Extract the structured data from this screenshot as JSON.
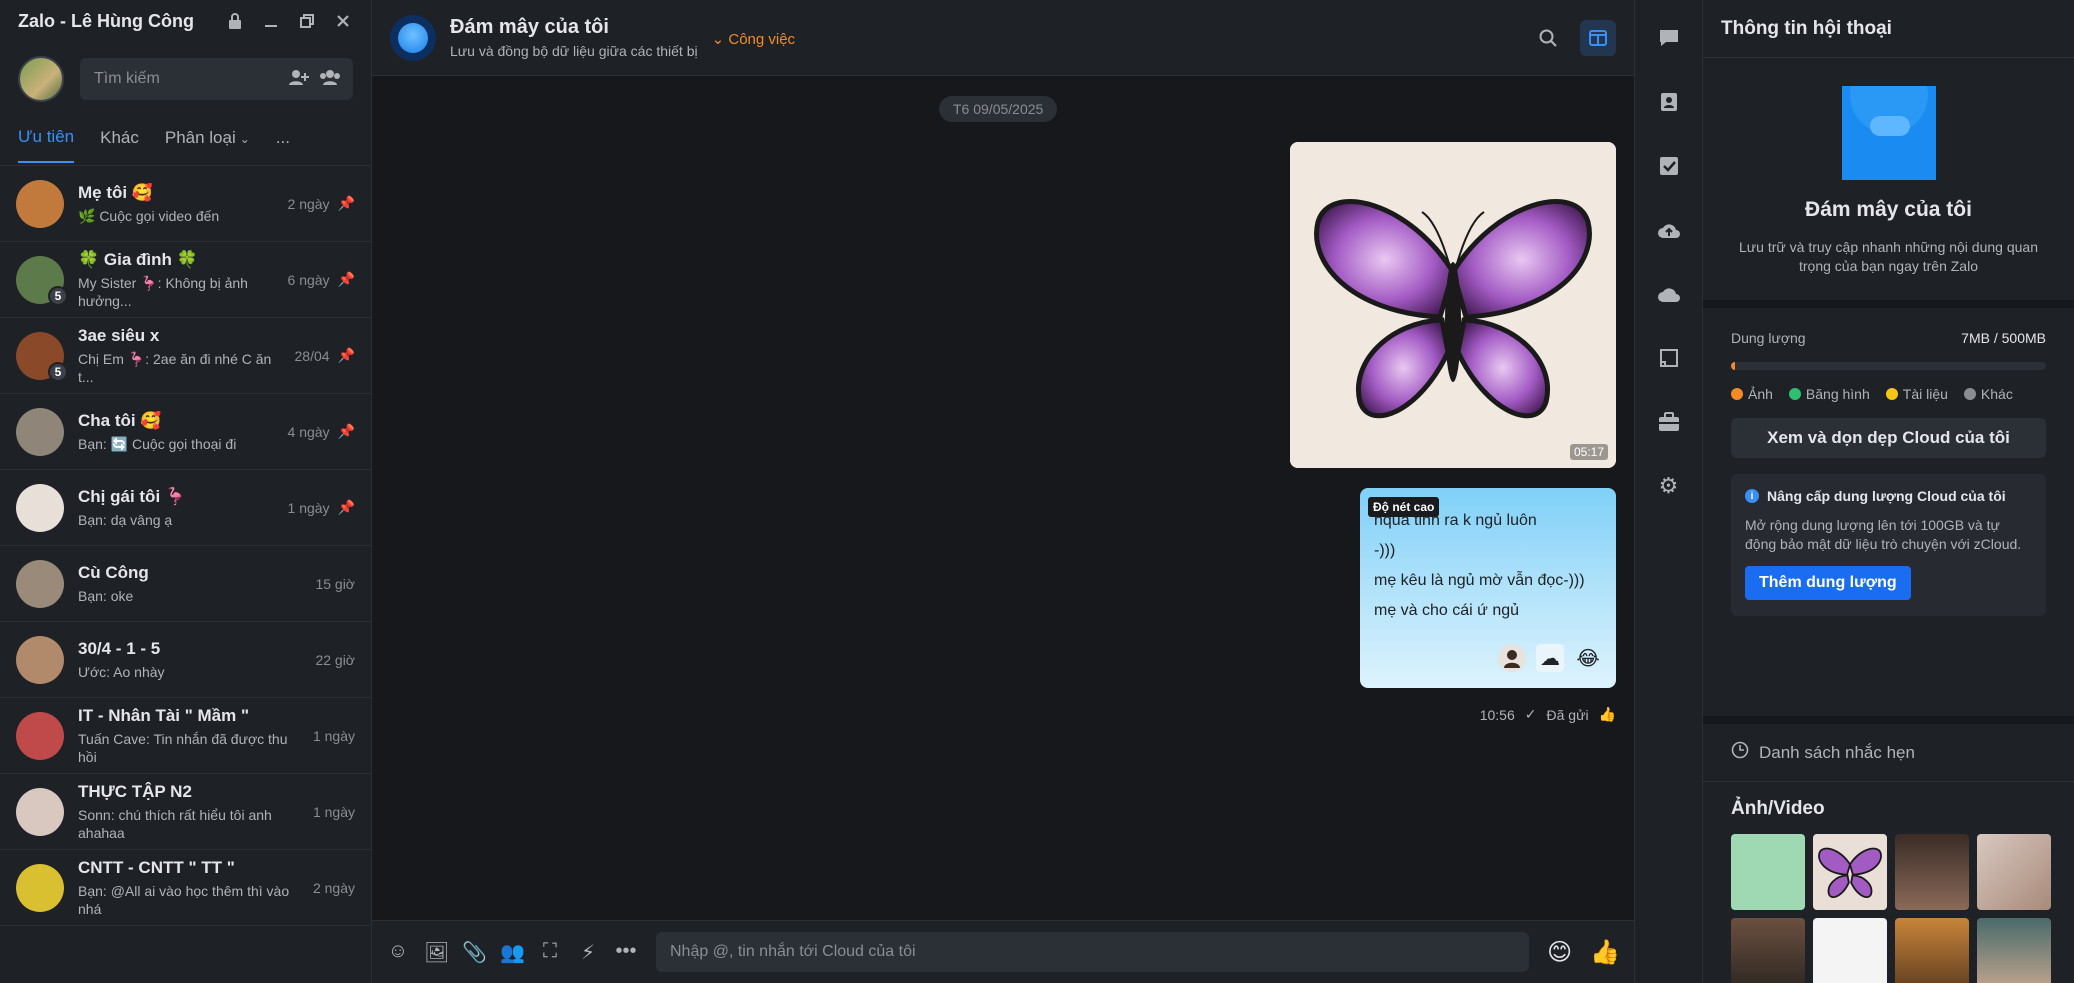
{
  "app": {
    "title": "Zalo - Lê Hùng Công"
  },
  "search": {
    "placeholder": "Tìm kiếm"
  },
  "tabs": [
    {
      "label": "Ưu tiên"
    },
    {
      "label": "Khác"
    },
    {
      "label": "Phân loại"
    }
  ],
  "tabs_more": "...",
  "conversations": [
    {
      "name": "Mẹ tôi 🥰",
      "preview": "🌿 Cuộc gọi video đến",
      "time": "2 ngày",
      "badge": "",
      "color": "#c27a3c"
    },
    {
      "name": "🍀 Gia đình 🍀",
      "preview": "My Sister 🦩: Không bị ảnh hưởng...",
      "time": "6 ngày",
      "badge": "5",
      "color": "#5d7a4a"
    },
    {
      "name": "3ae siêu x",
      "preview": "Chị Em 🦩: 2ae ăn đi nhé C ăn t...",
      "time": "28/04",
      "badge": "5",
      "color": "#8a4a2a"
    },
    {
      "name": "Cha tôi 🥰",
      "preview": "Bạn: 🔄 Cuộc gọi thoại đi",
      "time": "4 ngày",
      "badge": "",
      "color": "#8f8578"
    },
    {
      "name": "Chị gái tôi 🦩",
      "preview": "Bạn: dạ vâng ạ",
      "time": "1 ngày",
      "badge": "",
      "color": "#e8e0d8"
    },
    {
      "name": "Cù Công",
      "preview": "Bạn: oke",
      "time": "15 giờ",
      "badge": "",
      "color": "#9a8a7a"
    },
    {
      "name": "30/4 - 1 - 5",
      "preview": "Ước: Ao nhày",
      "time": "22 giờ",
      "badge": "",
      "color": "#b08a6a"
    },
    {
      "name": "IT - Nhân Tài \" Mầm \"",
      "preview": "Tuấn Cave: Tin nhắn đã được thu hồi",
      "time": "1 ngày",
      "badge": "",
      "color": "#c04a4a"
    },
    {
      "name": "THỰC TẬP N2",
      "preview": "Sonn: chú thích rất hiểu tôi anh ahahaa",
      "time": "1 ngày",
      "badge": "",
      "color": "#d8c8c0"
    },
    {
      "name": "CNTT - CNTT \" TT \"",
      "preview": "Bạn: @All ai vào học thêm thì vào nhá",
      "time": "2 ngày",
      "badge": "",
      "color": "#d8c030"
    }
  ],
  "chat": {
    "title": "Đám mây của tôi",
    "subtitle": "Lưu và đồng bộ dữ liệu giữa các thiết bị",
    "tag": "Công việc",
    "date": "T6 09/05/2025",
    "image_duration": "05:17",
    "hd_label": "Độ nét cao",
    "text_lines": [
      "hqua tỉnh ra k ngủ luôn",
      "-)))",
      "mẹ kêu là ngủ mờ vẫn đọc-)))",
      "mẹ và cho cái ứ ngủ"
    ],
    "time": "10:56",
    "status": "Đã gửi",
    "composer_placeholder": "Nhập @, tin nhắn tới Cloud của tôi"
  },
  "info": {
    "header": "Thông tin hội thoại",
    "name": "Đám mây của tôi",
    "description": "Lưu trữ và truy cập nhanh những nội dung quan trọng của bạn ngay trên Zalo",
    "capacity_label": "Dung lượng",
    "capacity_value": "7MB / 500MB",
    "capacity_fraction": 0.014,
    "legend": [
      {
        "label": "Ảnh",
        "color": "#f28b27"
      },
      {
        "label": "Băng hình",
        "color": "#2fbf71"
      },
      {
        "label": "Tài liệu",
        "color": "#f5c518"
      },
      {
        "label": "Khác",
        "color": "#8a8d91"
      }
    ],
    "clean_button": "Xem và dọn dẹp Cloud của tôi",
    "upgrade_title": "Nâng cấp dung lượng Cloud của tôi",
    "upgrade_desc": "Mở rộng dung lượng lên tới 100GB và tự động bảo mật dữ liệu trò chuyện với zCloud.",
    "upgrade_button": "Thêm dung lượng",
    "reminders": "Danh sách nhắc hẹn",
    "media_title": "Ảnh/Video"
  }
}
